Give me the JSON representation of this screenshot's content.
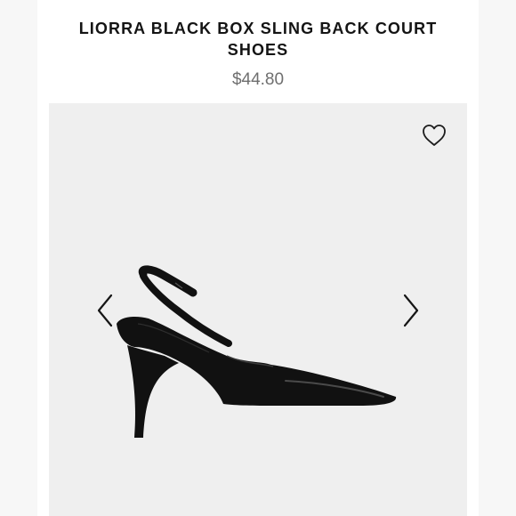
{
  "product": {
    "title": "LIORRA BLACK BOX SLING BACK COURT SHOES",
    "price": "$44.80"
  },
  "gallery": {
    "wishlist_icon": "heart-outline-icon",
    "prev_icon": "chevron-left-icon",
    "next_icon": "chevron-right-icon",
    "image_subject": "black patent slingback court shoe"
  },
  "colors": {
    "title": "#141414",
    "price": "#6f6f6f",
    "gallery_bg": "#efefef",
    "shoe": "#111111"
  }
}
